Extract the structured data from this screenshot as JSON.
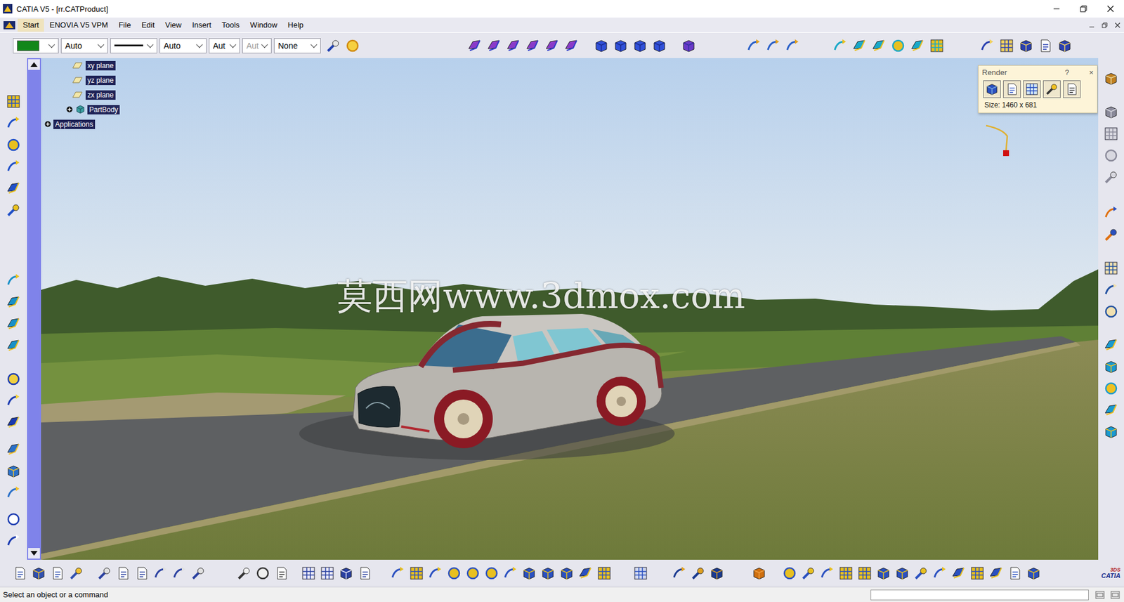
{
  "window": {
    "title": "CATIA V5 - [rr.CATProduct]"
  },
  "menu": [
    {
      "label": "Start",
      "selected": true
    },
    {
      "label": "ENOVIA V5 VPM",
      "selected": false
    },
    {
      "label": "File",
      "selected": false
    },
    {
      "label": "Edit",
      "selected": false
    },
    {
      "label": "View",
      "selected": false
    },
    {
      "label": "Insert",
      "selected": false
    },
    {
      "label": "Tools",
      "selected": false
    },
    {
      "label": "Window",
      "selected": false
    },
    {
      "label": "Help",
      "selected": false
    }
  ],
  "toolbar": {
    "current_color": "#12871a",
    "dropdowns": [
      {
        "label": "Auto",
        "disabled": false
      },
      {
        "label": "Auto",
        "disabled": false
      },
      {
        "label": "Aut",
        "disabled": false
      },
      {
        "label": "Aut",
        "disabled": true
      },
      {
        "label": "None",
        "disabled": false
      }
    ]
  },
  "tree": {
    "planes": [
      {
        "label": "xy plane"
      },
      {
        "label": "yz plane"
      },
      {
        "label": "zx plane"
      }
    ],
    "nodes": [
      {
        "label": "PartBody",
        "expanded": false
      },
      {
        "label": "Applications",
        "expanded": false
      }
    ]
  },
  "render": {
    "title": "Render",
    "help": "?",
    "close": "×",
    "size": "Size: 1460 x 681"
  },
  "watermark": "莫西网www.3dmox.com",
  "status_bar": {
    "message": "Select an object or a command",
    "input": ""
  },
  "logo": {
    "brand": "3DS",
    "product": "CATIA"
  }
}
